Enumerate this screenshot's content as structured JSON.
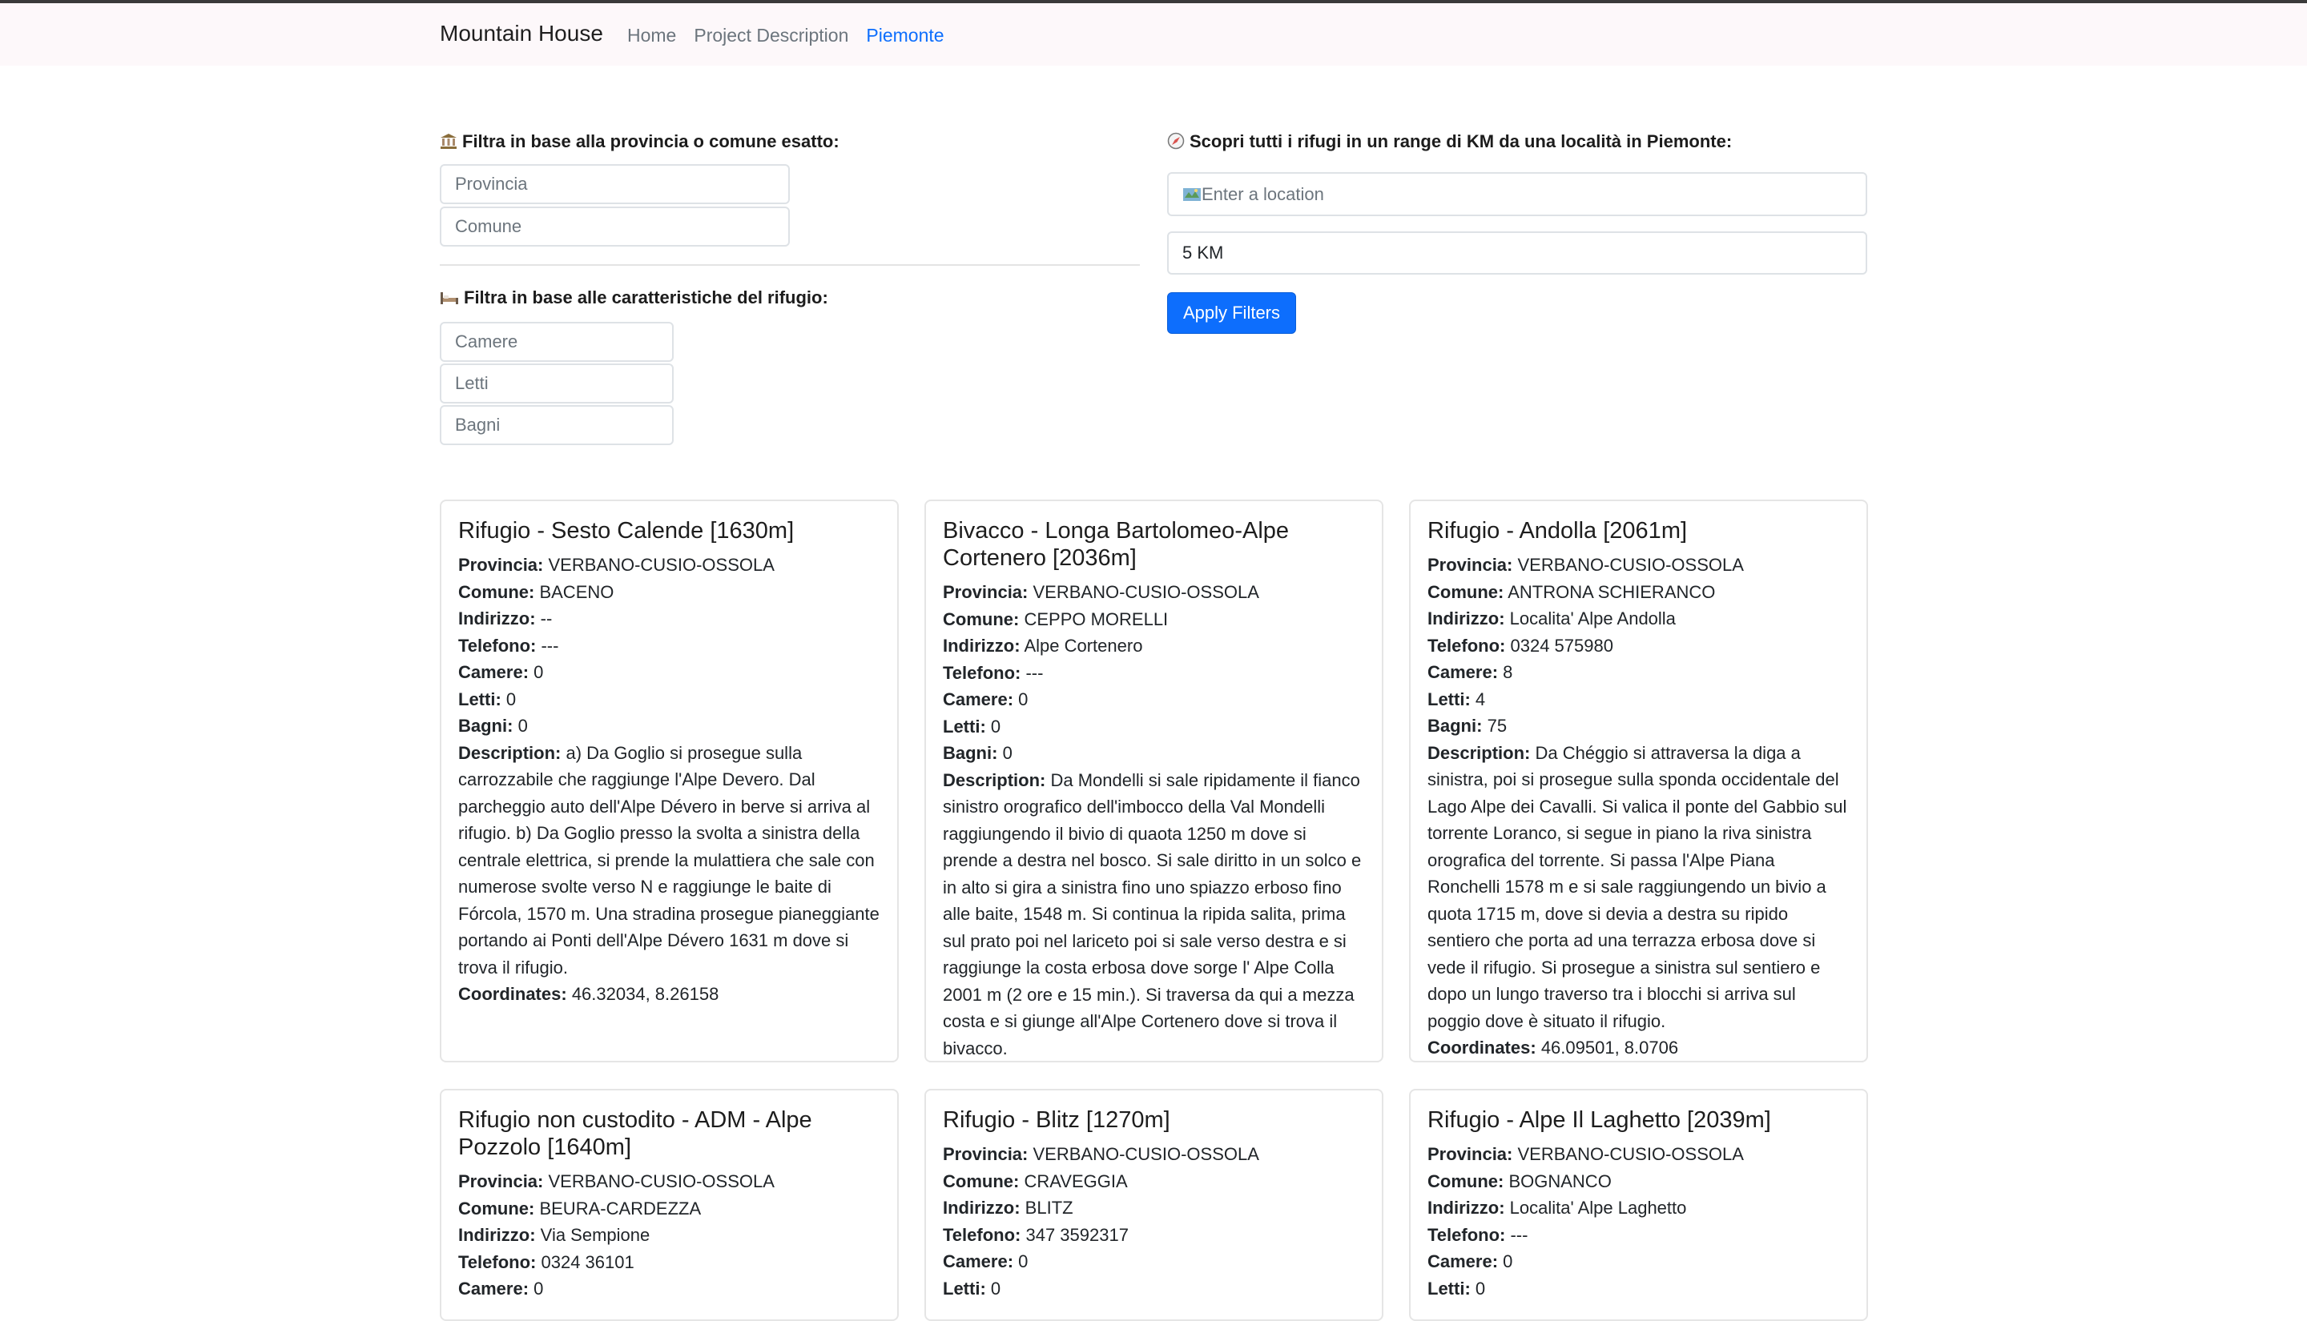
{
  "nav": {
    "brand": "Mountain House",
    "links": [
      "Home",
      "Project Description",
      "Piemonte"
    ]
  },
  "filters": {
    "location_label": "Filtra in base alla provincia o comune esatto:",
    "provincia_placeholder": "Provincia",
    "comune_placeholder": "Comune",
    "features_label": "Filtra in base alle caratteristiche del rifugio:",
    "camere_placeholder": "Camere",
    "letti_placeholder": "Letti",
    "bagni_placeholder": "Bagni",
    "range_label": "Scopri tutti i rifugi in un range di KM da una località in Piemonte:",
    "location_search_placeholder": "Enter a location",
    "km_value": "5 KM",
    "apply_label": "Apply Filters"
  },
  "labels": {
    "provincia": "Provincia:",
    "comune": "Comune:",
    "indirizzo": "Indirizzo:",
    "telefono": "Telefono:",
    "camere": "Camere:",
    "letti": "Letti:",
    "bagni": "Bagni:",
    "description": "Description:",
    "coordinates": "Coordinates:"
  },
  "cards": [
    {
      "title": "Rifugio - Sesto Calende [1630m]",
      "provincia": "VERBANO-CUSIO-OSSOLA",
      "comune": "BACENO",
      "indirizzo": "--",
      "telefono": "---",
      "camere": "0",
      "letti": "0",
      "bagni": "0",
      "description": "a) Da Goglio si prosegue sulla carrozzabile che raggiunge l'Alpe Devero. Dal parcheggio auto dell'Alpe Dévero in berve si arriva al rifugio. b) Da Goglio presso la svolta a sinistra della centrale elettrica, si prende la mulattiera che sale con numerose svolte verso N e raggiunge le baite di Fórcola, 1570 m. Una stradina prosegue pianeggiante portando ai Ponti dell'Alpe Dévero 1631 m dove si trova il rifugio.",
      "coordinates": "46.32034, 8.26158"
    },
    {
      "title": "Bivacco - Longa Bartolomeo-Alpe Cortenero [2036m]",
      "provincia": "VERBANO-CUSIO-OSSOLA",
      "comune": "CEPPO MORELLI",
      "indirizzo": "Alpe Cortenero",
      "telefono": "---",
      "camere": "0",
      "letti": "0",
      "bagni": "0",
      "description": "Da Mondelli si sale ripidamente il fianco sinistro orografico dell'imbocco della Val Mondelli raggiungendo il bivio di quaota 1250 m dove si prende a destra nel bosco. Si sale diritto in un solco e in alto si gira a sinistra fino uno spiazzo erboso fino alle baite, 1548 m. Si continua la ripida salita, prima sul prato poi nel lariceto poi si sale verso destra e si raggiunge la costa erbosa dove sorge l' Alpe Colla 2001 m (2 ore e 15 min.). Si traversa da qui a mezza costa e si giunge all'Alpe Cortenero dove si trova il bivacco.",
      "coordinates": ""
    },
    {
      "title": "Rifugio - Andolla [2061m]",
      "provincia": "VERBANO-CUSIO-OSSOLA",
      "comune": "ANTRONA SCHIERANCO",
      "indirizzo": "Localita' Alpe Andolla",
      "telefono": "0324 575980",
      "camere": "8",
      "letti": "4",
      "bagni": "75",
      "description": "Da Chéggio si attraversa la diga a sinistra, poi si prosegue sulla sponda occidentale del Lago Alpe dei Cavalli. Si valica il ponte del Gabbio sul torrente Loranco, si segue in piano la riva sinistra orografica del torrente. Si passa l'Alpe Piana Ronchelli 1578 m e si sale raggiungendo un bivio a quota 1715 m, dove si devia a destra su ripido sentiero che porta ad una terrazza erbosa dove si vede il rifugio. Si prosegue a sinistra sul sentiero e dopo un lungo traverso tra i blocchi si arriva sul poggio dove è situato il rifugio.",
      "coordinates": "46.09501, 8.0706"
    },
    {
      "title": "Rifugio non custodito - ADM - Alpe Pozzolo [1640m]",
      "provincia": "VERBANO-CUSIO-OSSOLA",
      "comune": "BEURA-CARDEZZA",
      "indirizzo": "Via Sempione",
      "telefono": "0324 36101",
      "camere": "0"
    },
    {
      "title": "Rifugio - Blitz [1270m]",
      "provincia": "VERBANO-CUSIO-OSSOLA",
      "comune": "CRAVEGGIA",
      "indirizzo": "BLITZ",
      "telefono": "347 3592317",
      "camere": "0",
      "letti": "0"
    },
    {
      "title": "Rifugio - Alpe Il Laghetto [2039m]",
      "provincia": "VERBANO-CUSIO-OSSOLA",
      "comune": "BOGNANCO",
      "indirizzo": "Localita' Alpe Laghetto",
      "telefono": "---",
      "camere": "0",
      "letti": "0"
    }
  ]
}
